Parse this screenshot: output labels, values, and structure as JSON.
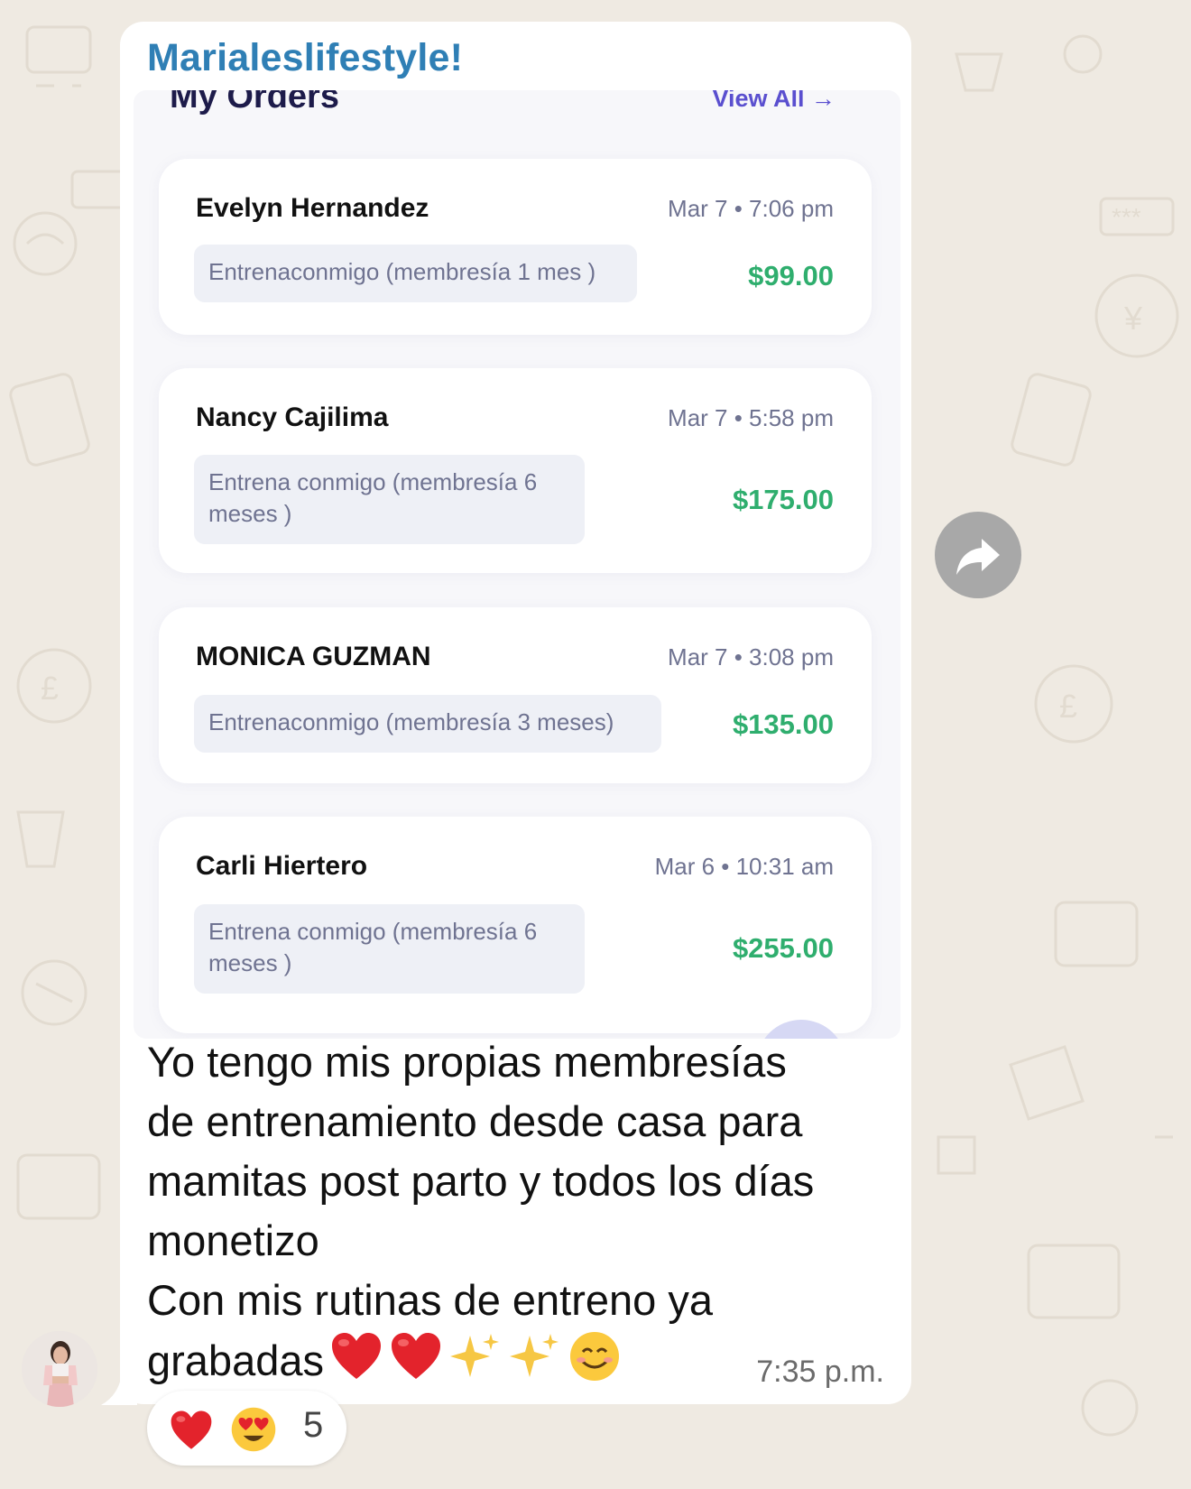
{
  "chat": {
    "sender": "Marialeslifestyle!",
    "message_lines": [
      "Yo tengo mis propias membresías",
      "de entrenamiento desde casa para",
      "mamitas post parto y todos los días",
      "monetizo",
      "Con mis rutinas de entreno ya",
      "grabadas"
    ],
    "message_emojis": [
      "red-heart",
      "red-heart",
      "sparkles",
      "sparkles",
      "smiling-face"
    ],
    "time": "7:35 p.m.",
    "reactions": {
      "emojis": [
        "red-heart",
        "heart-eyes-face"
      ],
      "count": "5"
    }
  },
  "screenshot": {
    "title": "My Orders",
    "view_all": "View All →",
    "orders": [
      {
        "customer": "Evelyn Hernandez",
        "date": "Mar 7 • 7:06 pm",
        "product": "Entrenaconmigo (membresía 1 mes )",
        "price": "$99.00"
      },
      {
        "customer": "Nancy Cajilima",
        "date": "Mar 7 • 5:58 pm",
        "product": "Entrena conmigo (membresía 6 meses )",
        "price": "$175.00"
      },
      {
        "customer": "MONICA GUZMAN",
        "date": "Mar 7 • 3:08 pm",
        "product": "Entrenaconmigo (membresía 3 meses)",
        "price": "$135.00"
      },
      {
        "customer": "Carli Hiertero",
        "date": "Mar 6 • 10:31 am",
        "product": "Entrena conmigo (membresía 6 meses )",
        "price": "$255.00"
      }
    ]
  },
  "colors": {
    "background": "#efeae2",
    "sender": "#2f7fb5",
    "price": "#2fae6e",
    "view_all": "#5a4fcf"
  }
}
